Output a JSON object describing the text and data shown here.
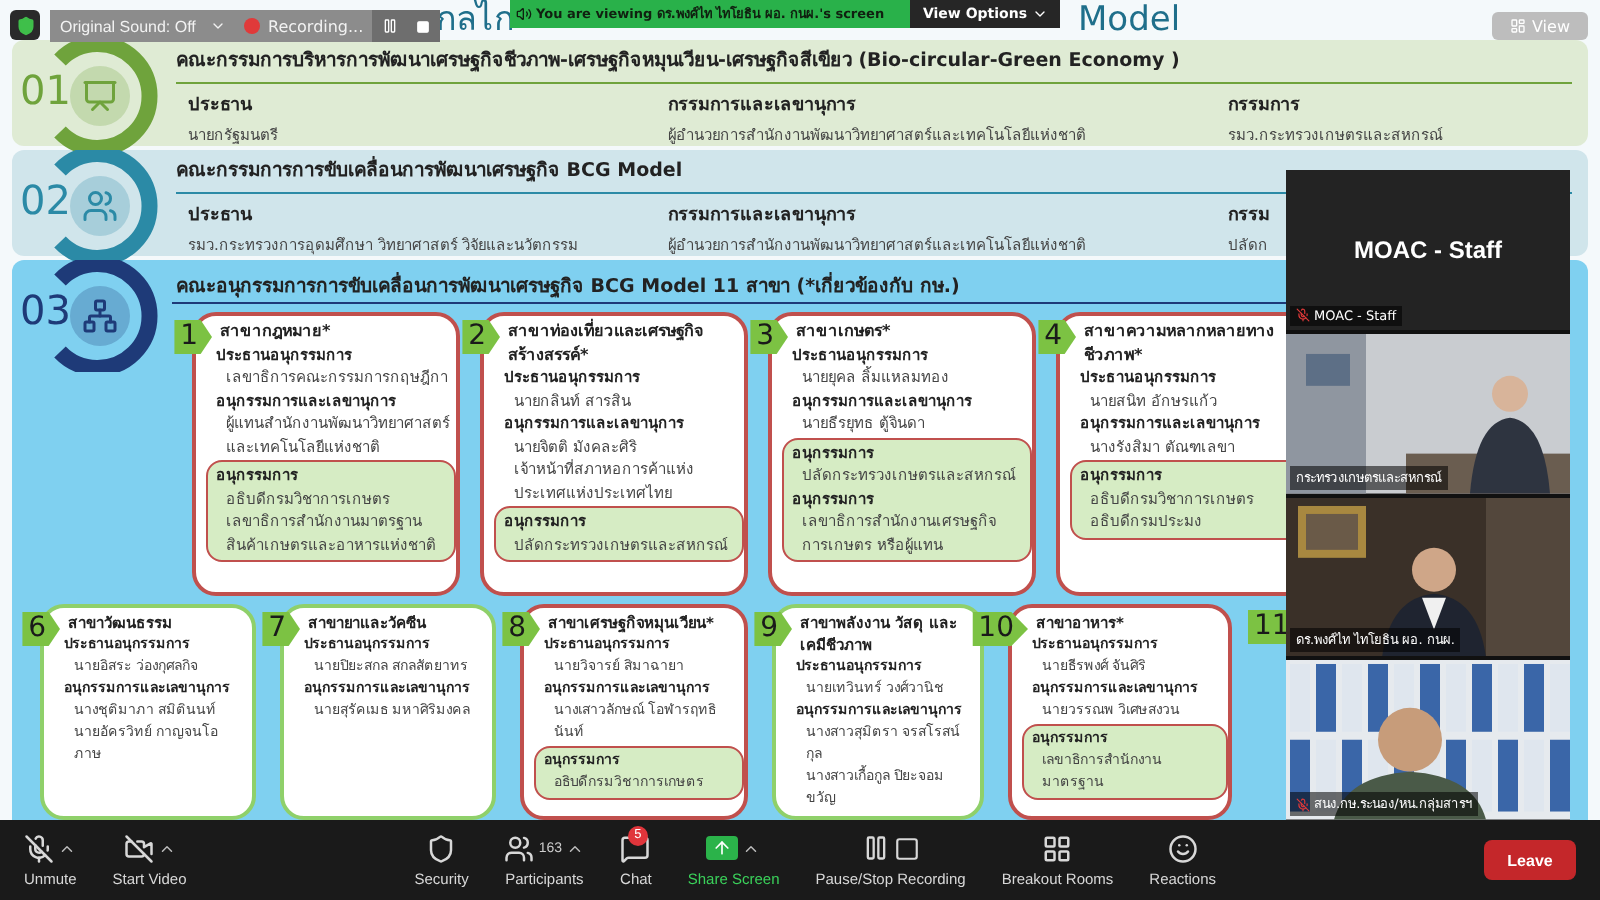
{
  "overlay": {
    "original_sound": "Original Sound: Off",
    "recording": "Recording...",
    "viewing_banner": "You are viewing ดร.พงศ์ไท ไทโยธิน ผอ. กนผ.'s screen",
    "view_options": "View Options",
    "view": "View"
  },
  "slide": {
    "title_parts": [
      "กลไก",
      "Model"
    ],
    "committees": [
      {
        "number": "01",
        "color": "#6fa33c",
        "title": "คณะกรรมการบริหารการพัฒนาเศรษฐกิจชีวภาพ-เศรษฐกิจหมุนเวียน-เศรษฐกิจสีเขียว (Bio-circular-Green Economy )",
        "columns": [
          {
            "label": "ประธาน",
            "value": "นายกรัฐมนตรี"
          },
          {
            "label": "กรรมการและเลขานุการ",
            "value": "ผู้อำนวยการสำนักงานพัฒนาวิทยาศาสตร์และเทคโนโลยีแห่งชาติ"
          },
          {
            "label": "กรรมการ",
            "value": "รมว.กระทรวงเกษตรและสหกรณ์"
          }
        ]
      },
      {
        "number": "02",
        "color": "#2b8aa6",
        "title": "คณะกรรมการการขับเคลื่อนการพัฒนาเศรษฐกิจ BCG Model",
        "columns": [
          {
            "label": "ประธาน",
            "value": "รมว.กระทรวงการอุดมศึกษา วิทยาศาสตร์ วิจัยและนวัตกรรม"
          },
          {
            "label": "กรรมการและเลขานุการ",
            "value": "ผู้อำนวยการสำนักงานพัฒนาวิทยาศาสตร์และเทคโนโลยีแห่งชาติ"
          },
          {
            "label": "กรรม",
            "value": "ปลัดก"
          }
        ]
      }
    ],
    "subcommittee": {
      "number": "03",
      "color": "#1e3a78",
      "title": "คณะอนุกรรมการการขับเคลื่อนการพัฒนาเศรษฐกิจ BCG Model 11 สาขา (*เกี่ยวข้องกับ กษ.)",
      "upper_cards": [
        {
          "number": "1",
          "related": true,
          "title": "สาขากฎหมาย*",
          "sections": [
            {
              "label": "ประธานอนุกรรมการ",
              "values": [
                "เลขาธิการคณะกรรมการกฤษฎีกา"
              ]
            },
            {
              "label": "อนุกรรมการและเลขานุการ",
              "values": [
                "ผู้แทนสำนักงานพัฒนาวิทยาศาสตร์และเทคโนโลยีแห่งชาติ"
              ]
            }
          ],
          "members": [
            {
              "label": "อนุกรรมการ",
              "values": [
                "อธิบดีกรมวิชาการเกษตร",
                "เลขาธิการสำนักงานมาตรฐานสินค้าเกษตรและอาหารแห่งชาติ"
              ]
            }
          ]
        },
        {
          "number": "2",
          "related": true,
          "title": "สาขาท่องเที่ยวและเศรษฐกิจสร้างสรรค์*",
          "sections": [
            {
              "label": "ประธานอนุกรรมการ",
              "values": [
                "นายกลินท์ สารสิน"
              ]
            },
            {
              "label": "อนุกรรมการและเลขานุการ",
              "values": [
                "นายจิตติ มังคละศิริ",
                "เจ้าหน้าที่สภาหอการค้าแห่งประเทศแห่งประเทศไทย"
              ]
            }
          ],
          "members": [
            {
              "label": "อนุกรรมการ",
              "values": [
                "ปลัดกระทรวงเกษตรและสหกรณ์"
              ]
            }
          ]
        },
        {
          "number": "3",
          "related": true,
          "title": "สาขาเกษตร*",
          "sections": [
            {
              "label": "ประธานอนุกรรมการ",
              "values": [
                "นายยุคล ลิ้มแหลมทอง"
              ]
            },
            {
              "label": "อนุกรรมการและเลขานุการ",
              "values": [
                "นายธีรยุทธ ตู้จินดา"
              ]
            }
          ],
          "members": [
            {
              "label": "อนุกรรมการ",
              "values": [
                "ปลัดกระทรวงเกษตรและสหกรณ์"
              ]
            },
            {
              "label": "อนุกรรมการ",
              "values": [
                "เลขาธิการสำนักงานเศรษฐกิจการเกษตร หรือผู้แทน"
              ]
            }
          ]
        },
        {
          "number": "4",
          "related": true,
          "title": "สาขาความหลากหลายทางชีวภาพ*",
          "sections": [
            {
              "label": "ประธานอนุกรรมการ",
              "values": [
                "นายสนิท อักษรแก้ว"
              ]
            },
            {
              "label": "อนุกรรมการและเลขานุการ",
              "values": [
                "นางรังสิมา ตัณฑเลขา"
              ]
            }
          ],
          "members": [
            {
              "label": "อนุกรรมการ",
              "values": [
                "อธิบดีกรมวิชาการเกษตร",
                "อธิบดีกรมประมง"
              ]
            }
          ]
        }
      ],
      "lower_cards": [
        {
          "number": "6",
          "related": false,
          "title": "สาขาวัฒนธรรม",
          "sections": [
            {
              "label": "ประธานอนุกรรมการ",
              "values": [
                "นายอิสระ ว่องกุศลกิจ"
              ]
            },
            {
              "label": "อนุกรรมการและเลขานุการ",
              "values": [
                "นางชุติมาภา สมิตินนท์",
                "นายอัครวิทย์ กาญจนโอภาษ"
              ]
            }
          ]
        },
        {
          "number": "7",
          "related": false,
          "title": "สาขายาและวัคซีน",
          "sections": [
            {
              "label": "ประธานอนุกรรมการ",
              "values": [
                "นายปิยะสกล สกลสัตยาทร"
              ]
            },
            {
              "label": "อนุกรรมการและเลขานุการ",
              "values": [
                "นายสุรัคเมธ มหาศิริมงคล"
              ]
            }
          ]
        },
        {
          "number": "8",
          "related": true,
          "title": "สาขาเศรษฐกิจหมุนเวียน*",
          "sections": [
            {
              "label": "ประธานอนุกรรมการ",
              "values": [
                "นายวิจารย์ สิมาฉายา"
              ]
            },
            {
              "label": "อนุกรรมการและเลขานุการ",
              "values": [
                "นางเสาวลักษณ์ โอฬารฤทธินันท์"
              ]
            }
          ],
          "members": [
            {
              "label": "อนุกรรมการ",
              "values": [
                "อธิบดีกรมวิชาการเกษตร"
              ]
            }
          ]
        },
        {
          "number": "9",
          "related": false,
          "title": "สาขาพลังงาน วัสดุ และเคมีชีวภาพ",
          "sections": [
            {
              "label": "ประธานอนุกรรมการ",
              "values": [
                "นายเทวินทร์ วงศ์วานิช"
              ]
            },
            {
              "label": "อนุกรรมการและเลขานุการ",
              "values": [
                "นางสาวสุมิตรา จรสโรสน์กุล",
                "นางสาวเกื้อกูล ปิยะจอมขวัญ"
              ]
            }
          ]
        },
        {
          "number": "10",
          "related": true,
          "title": "สาขาอาหาร*",
          "sections": [
            {
              "label": "ประธานอนุกรรมการ",
              "values": [
                "นายธีรพงศ์ จันศิริ"
              ]
            },
            {
              "label": "อนุกรรมการและเลขานุการ",
              "values": [
                "นายวรรณพ วิเศษสงวน"
              ]
            }
          ],
          "members": [
            {
              "label": "อนุกรรมการ",
              "values": [
                "เลขาธิการสำนักงานมาตรฐาน"
              ]
            }
          ]
        },
        {
          "number": "11"
        }
      ]
    }
  },
  "video_tiles": [
    {
      "kind": "placeholder",
      "display_name": "MOAC - Staff",
      "caption": "MOAC - Staff",
      "muted": true
    },
    {
      "kind": "office",
      "caption": "กระทรวงเกษตรและสหกรณ์",
      "muted": false
    },
    {
      "kind": "speaker",
      "caption": "ดร.พงศ์ไท ไทโยธิน ผอ. กนผ.",
      "muted": false
    },
    {
      "kind": "shelves",
      "caption": "สนง.กษ.ระนอง/หน.กลุ่มสารฯ",
      "muted": true
    }
  ],
  "toolbar": {
    "items": [
      {
        "kind": "mic",
        "label": "Unmute",
        "caret": true
      },
      {
        "kind": "video",
        "label": "Start Video",
        "caret": true
      },
      {
        "kind": "security",
        "label": "Security",
        "caret": false
      },
      {
        "kind": "participants",
        "label": "Participants",
        "count": "163",
        "caret": true
      },
      {
        "kind": "chat",
        "label": "Chat",
        "badge": "5",
        "caret": false
      },
      {
        "kind": "share",
        "label": "Share Screen",
        "caret": true
      },
      {
        "kind": "record",
        "label": "Pause/Stop Recording",
        "caret": false
      },
      {
        "kind": "breakout",
        "label": "Breakout Rooms",
        "caret": false
      },
      {
        "kind": "reactions",
        "label": "Reactions",
        "caret": false
      }
    ],
    "leave": "Leave"
  }
}
